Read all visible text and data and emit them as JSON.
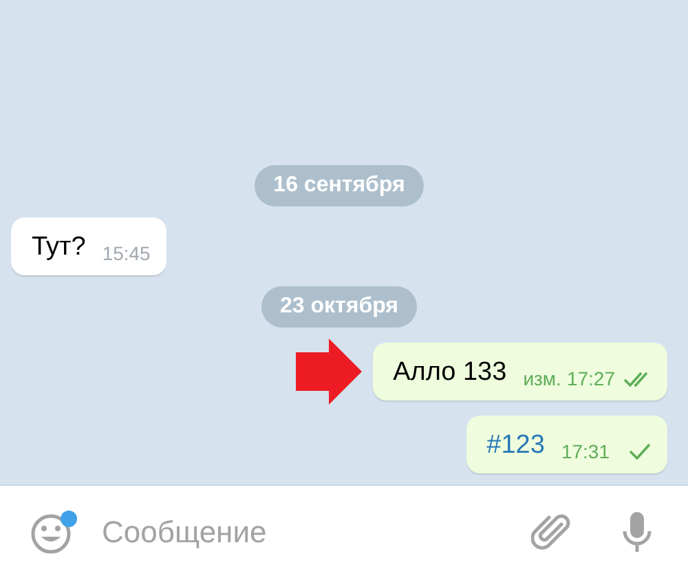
{
  "messages": [
    {
      "kind": "date",
      "text": "16 сентября"
    },
    {
      "kind": "incoming",
      "text": "Тут?",
      "time": "15:45"
    },
    {
      "kind": "date",
      "text": "23 октября"
    },
    {
      "kind": "outgoing",
      "text": "Алло 133",
      "edited_label": "изм.",
      "time": "17:27",
      "read": true,
      "hashtag": false,
      "marked": true
    },
    {
      "kind": "outgoing",
      "text": "#123",
      "time": "17:31",
      "read": false,
      "hashtag": true,
      "marked": false
    }
  ],
  "composer": {
    "placeholder": "Сообщение",
    "emoji_badge": true
  }
}
